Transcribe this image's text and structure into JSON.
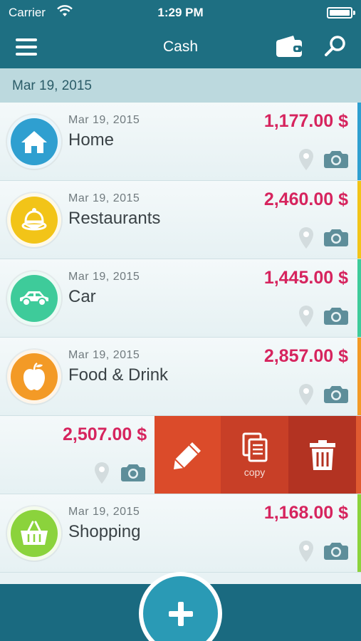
{
  "status_bar": {
    "carrier": "Carrier",
    "time": "1:29 PM"
  },
  "nav": {
    "title": "Cash"
  },
  "section": {
    "date": "Mar 19, 2015"
  },
  "transactions": [
    {
      "date": "Mar 19, 2015",
      "name": "Home",
      "amount": "1,177.00 $",
      "icon": "home-icon",
      "color": "#2f9fd0",
      "accent": "#2f9fd0"
    },
    {
      "date": "Mar 19, 2015",
      "name": "Restaurants",
      "amount": "2,460.00 $",
      "icon": "cake-icon",
      "color": "#f2c418",
      "accent": "#f2c418"
    },
    {
      "date": "Mar 19, 2015",
      "name": "Car",
      "amount": "1,445.00 $",
      "icon": "car-icon",
      "color": "#3ecb9a",
      "accent": "#3ecb9a"
    },
    {
      "date": "Mar 19, 2015",
      "name": "Food & Drink",
      "amount": "2,857.00 $",
      "icon": "apple-icon",
      "color": "#f39a26",
      "accent": "#f39a26"
    },
    {
      "amount": "2,507.00 $",
      "swiped": true
    },
    {
      "date": "Mar 19, 2015",
      "name": "Shopping",
      "amount": "1,168.00 $",
      "icon": "basket-icon",
      "color": "#8bd33c",
      "accent": "#8bd33c"
    }
  ],
  "swipe_actions": {
    "copy_label": "copy"
  },
  "colors": {
    "bar": "#1e6f82",
    "amount": "#d6245e",
    "edit": "#db4b2a",
    "copy": "#c83f27",
    "delete": "#b33322"
  }
}
